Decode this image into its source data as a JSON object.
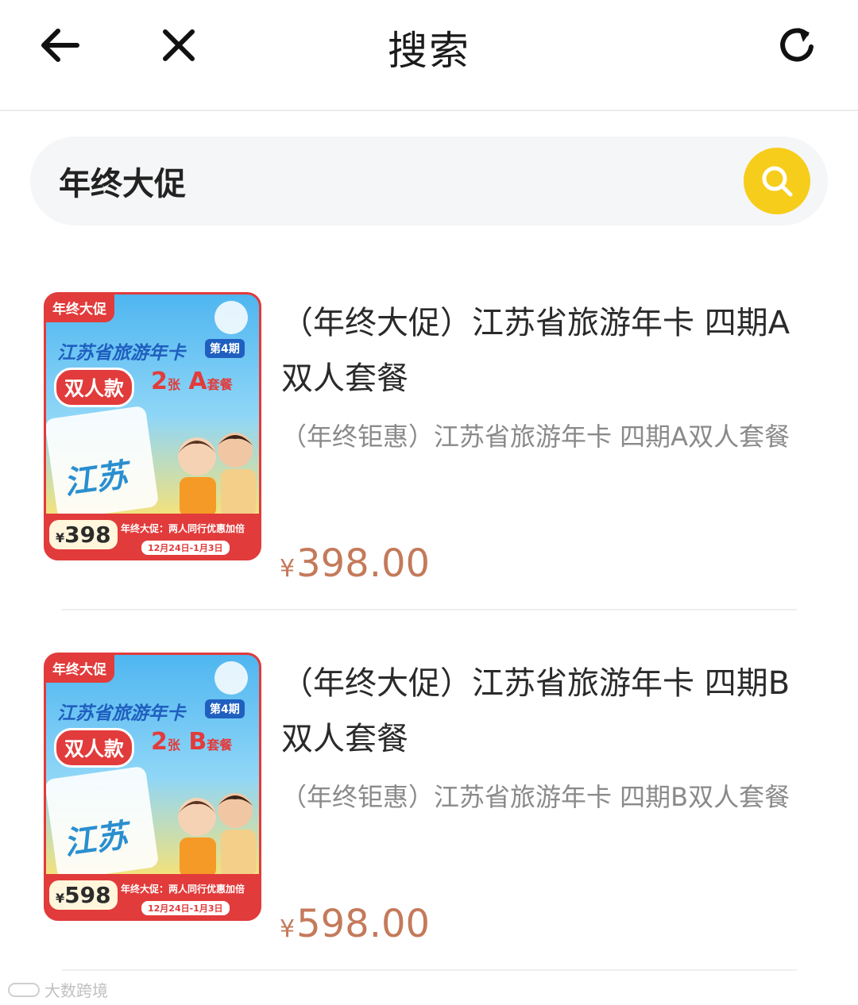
{
  "header": {
    "back_icon": "arrow-left-icon",
    "close_icon": "close-icon",
    "title": "搜索",
    "refresh_icon": "refresh-icon"
  },
  "search": {
    "value": "年终大促",
    "button_icon": "search-icon",
    "button_color": "#f7cd1b"
  },
  "results": [
    {
      "title": "（年终大促）江苏省旅游年卡 四期A双人套餐",
      "subtitle": "（年终钜惠）江苏省旅游年卡 四期A双人套餐",
      "price_symbol": "¥",
      "price": "398.00",
      "thumb": {
        "tag": "年终大促",
        "heading": "江苏省旅游年卡",
        "period": "第4期",
        "badge": "双人款",
        "combo_count": "2",
        "combo_unit": "张",
        "combo_letter": "A",
        "combo_suffix": "套餐",
        "card_text": "江苏",
        "price_symbol": "¥",
        "price": "398",
        "promo": "年终大促：两人同行优惠加倍",
        "date": "12月24日-1月3日"
      }
    },
    {
      "title": "（年终大促）江苏省旅游年卡 四期B双人套餐",
      "subtitle": "（年终钜惠）江苏省旅游年卡 四期B双人套餐",
      "price_symbol": "¥",
      "price": "598.00",
      "thumb": {
        "tag": "年终大促",
        "heading": "江苏省旅游年卡",
        "period": "第4期",
        "badge": "双人款",
        "combo_count": "2",
        "combo_unit": "张",
        "combo_letter": "B",
        "combo_suffix": "套餐",
        "card_text": "江苏",
        "price_symbol": "¥",
        "price": "598",
        "promo": "年终大促：两人同行优惠加倍",
        "date": "12月24日-1月3日"
      }
    }
  ],
  "colors": {
    "price": "#c47a5a",
    "accent_red": "#e23b3b",
    "accent_yellow": "#f7cd1b"
  },
  "watermark": "大数跨境"
}
